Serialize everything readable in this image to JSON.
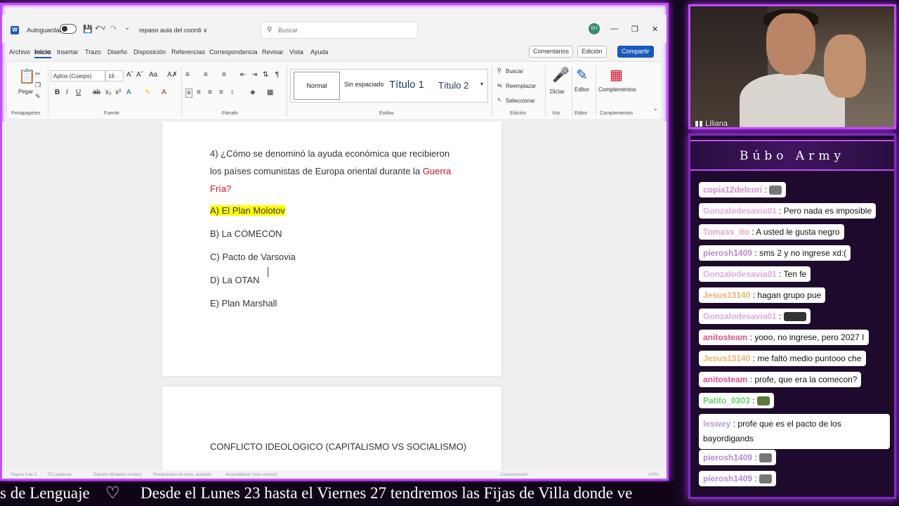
{
  "word": {
    "autosave_label": "Autoguardado",
    "doc_name": "repaso aula del coordi ∨",
    "search_placeholder": "Buscar",
    "avatar_initials": "EH",
    "menu": [
      "Archivo",
      "Inicio",
      "Insertar",
      "Trazo",
      "Diseño",
      "Disposición",
      "Referencias",
      "Correspondencia",
      "Revisar",
      "Vista",
      "Ayuda"
    ],
    "comments_label": "Comentarios",
    "editing_label": "Edición",
    "share_label": "Compartir",
    "ribbon": {
      "paste_label": "Pegar",
      "font_name": "Aptos (Cuerpo)",
      "font_size": "16",
      "styles": {
        "normal": "Normal",
        "no_spacing": "Sin espaciado",
        "title1": "Título 1",
        "title2": "Título 2"
      },
      "find": "Buscar",
      "replace": "Reemplazar",
      "select": "Seleccionar",
      "dictate": "Dictar",
      "editor": "Editor",
      "addins": "Complementos",
      "groups": {
        "clipboard": "Portapapeles",
        "font": "Fuente",
        "paragraph": "Párrafo",
        "styles": "Estilos",
        "editing": "Edición",
        "voice": "Voz",
        "editor": "Editor",
        "addins": "Complementos"
      }
    },
    "document": {
      "question_part1": "4) ¿Cómo se denominó la ayuda económica que recibieron los países comunistas de Europa oriental durante la ",
      "question_red": "Guerra Fría?",
      "options": [
        "A) El Plan Molotov",
        "B) La COMECON",
        "C) Pacto de Varsovia",
        "D) La OTAN",
        "E) Plan Marshall"
      ],
      "page2_title": "CONFLICTO IDEOLOGICO (CAPITALISMO VS SOCIALISMO)"
    },
    "status": {
      "page": "Página 3 de 5",
      "words": "752 palabras",
      "lang": "Español (Estados Unidos)",
      "predict": "Predicciones de texto: activado",
      "access": "Accesibilidad: todo correcto",
      "focus": "Concentración",
      "zoom": "100%"
    }
  },
  "ticker": {
    "left": "s de Lenguaje",
    "heart": "♡",
    "main": "Desde el Lunes 23 hasta el Viernes 27 tendremos las Fijas de Villa donde ve"
  },
  "cam": {
    "name": "Liliana"
  },
  "chat": {
    "title": "Búbo Army",
    "messages": [
      {
        "user": "copia12delcori",
        "color": "#d98cd6",
        "text": "",
        "emote": "cat"
      },
      {
        "user": "Gonzalodesavia01",
        "color": "#e0a8e0",
        "text": "Pero nada es imposible",
        "emote": ""
      },
      {
        "user": "Tomass_ito",
        "color": "#e7a3c9",
        "text": "A usted le gusta negro",
        "emote": ""
      },
      {
        "user": "pierosh1409",
        "color": "#b889d9",
        "text": "sms 2 y no ingrese xd:(",
        "emote": ""
      },
      {
        "user": "Gonzalodesavia01",
        "color": "#e0a8e0",
        "text": "Ten fe",
        "emote": ""
      },
      {
        "user": "Jesus13140",
        "color": "#f0b26a",
        "text": "hagan grupo pue",
        "emote": ""
      },
      {
        "user": "Gonzalodesavia01",
        "color": "#e0a8e0",
        "text": "",
        "emote": "dark"
      },
      {
        "user": "anitosteam",
        "color": "#e0508a",
        "text": "yooo, no ingrese, pero 2027 I",
        "emote": ""
      },
      {
        "user": "Jesus13140",
        "color": "#f0b26a",
        "text": "me faltó medio puntooo che",
        "emote": ""
      },
      {
        "user": "anitosteam",
        "color": "#e0508a",
        "text": "profe, que era la comecon?",
        "emote": ""
      },
      {
        "user": "Patito_0303",
        "color": "#5fd46a",
        "text": "",
        "emote": "frog"
      },
      {
        "user": "leswey",
        "color": "#b99ae0",
        "text": "profe que es el pacto de los",
        "text2": "bayordigands",
        "emote": ""
      },
      {
        "user": "pierosh1409",
        "color": "#b889d9",
        "text": "",
        "emote": "cat"
      },
      {
        "user": "pierosh1409",
        "color": "#b889d9",
        "text": "",
        "emote": "cat"
      }
    ]
  }
}
